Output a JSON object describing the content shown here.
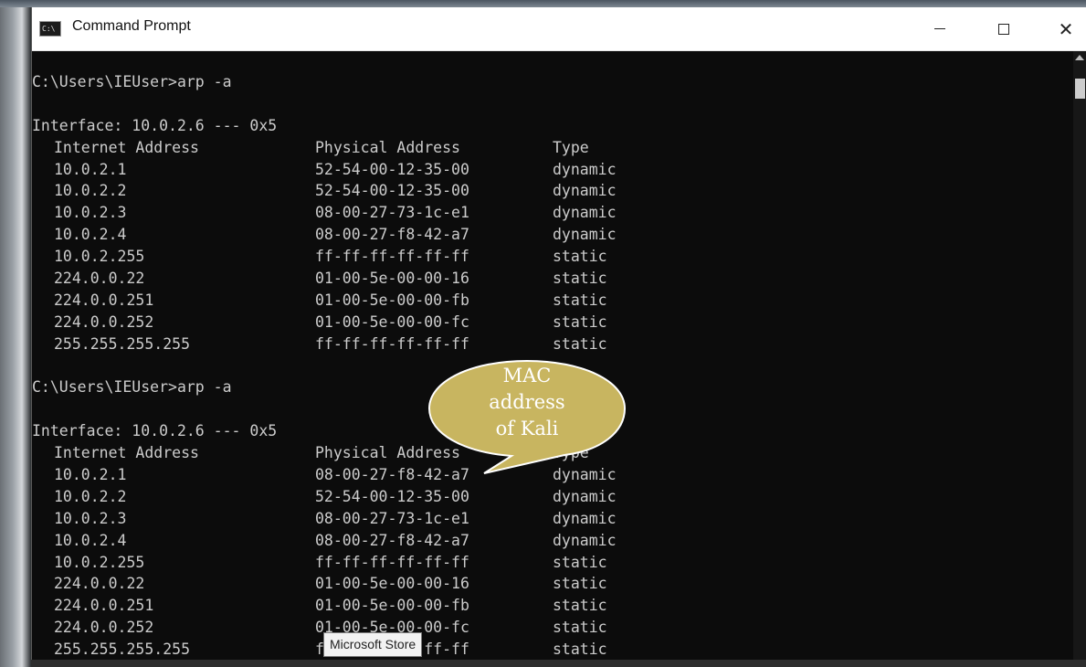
{
  "window": {
    "title": "Command Prompt",
    "icon": "console-app-icon"
  },
  "console": {
    "lines": [
      {
        "kind": "cmd",
        "text": "C:\\Users\\IEUser>arp -a"
      },
      {
        "kind": "blank",
        "text": ""
      },
      {
        "kind": "text",
        "text": "Interface: 10.0.2.6 --- 0x5"
      },
      {
        "kind": "row",
        "c1": "Internet Address",
        "c2": "Physical Address",
        "c3": "Type"
      },
      {
        "kind": "row",
        "c1": "10.0.2.1",
        "c2": "52-54-00-12-35-00",
        "c3": "dynamic"
      },
      {
        "kind": "row",
        "c1": "10.0.2.2",
        "c2": "52-54-00-12-35-00",
        "c3": "dynamic"
      },
      {
        "kind": "row",
        "c1": "10.0.2.3",
        "c2": "08-00-27-73-1c-e1",
        "c3": "dynamic"
      },
      {
        "kind": "row",
        "c1": "10.0.2.4",
        "c2": "08-00-27-f8-42-a7",
        "c3": "dynamic"
      },
      {
        "kind": "row",
        "c1": "10.0.2.255",
        "c2": "ff-ff-ff-ff-ff-ff",
        "c3": "static"
      },
      {
        "kind": "row",
        "c1": "224.0.0.22",
        "c2": "01-00-5e-00-00-16",
        "c3": "static"
      },
      {
        "kind": "row",
        "c1": "224.0.0.251",
        "c2": "01-00-5e-00-00-fb",
        "c3": "static"
      },
      {
        "kind": "row",
        "c1": "224.0.0.252",
        "c2": "01-00-5e-00-00-fc",
        "c3": "static"
      },
      {
        "kind": "row",
        "c1": "255.255.255.255",
        "c2": "ff-ff-ff-ff-ff-ff",
        "c3": "static"
      },
      {
        "kind": "blank",
        "text": ""
      },
      {
        "kind": "cmd",
        "text": "C:\\Users\\IEUser>arp -a"
      },
      {
        "kind": "blank",
        "text": ""
      },
      {
        "kind": "text",
        "text": "Interface: 10.0.2.6 --- 0x5"
      },
      {
        "kind": "row",
        "c1": "Internet Address",
        "c2": "Physical Address",
        "c3": "Type"
      },
      {
        "kind": "row",
        "c1": "10.0.2.1",
        "c2": "08-00-27-f8-42-a7",
        "c3": "dynamic"
      },
      {
        "kind": "row",
        "c1": "10.0.2.2",
        "c2": "52-54-00-12-35-00",
        "c3": "dynamic"
      },
      {
        "kind": "row",
        "c1": "10.0.2.3",
        "c2": "08-00-27-73-1c-e1",
        "c3": "dynamic"
      },
      {
        "kind": "row",
        "c1": "10.0.2.4",
        "c2": "08-00-27-f8-42-a7",
        "c3": "dynamic"
      },
      {
        "kind": "row",
        "c1": "10.0.2.255",
        "c2": "ff-ff-ff-ff-ff-ff",
        "c3": "static"
      },
      {
        "kind": "row",
        "c1": "224.0.0.22",
        "c2": "01-00-5e-00-00-16",
        "c3": "static"
      },
      {
        "kind": "row",
        "c1": "224.0.0.251",
        "c2": "01-00-5e-00-00-fb",
        "c3": "static"
      },
      {
        "kind": "row",
        "c1": "224.0.0.252",
        "c2": "01-00-5e-00-00-fc",
        "c3": "static"
      },
      {
        "kind": "row",
        "c1": "255.255.255.255",
        "c2": "ff-ff-ff-ff-ff-ff",
        "c3": "static"
      }
    ]
  },
  "callout": {
    "lines": [
      "MAC",
      "address",
      "of Kali"
    ],
    "fill": "#c8b560"
  },
  "tooltip": {
    "text": "Microsoft Store"
  },
  "colors": {
    "console_bg": "#0c0c0c",
    "console_fg": "#cccccc",
    "titlebar_bg": "#ffffff"
  }
}
